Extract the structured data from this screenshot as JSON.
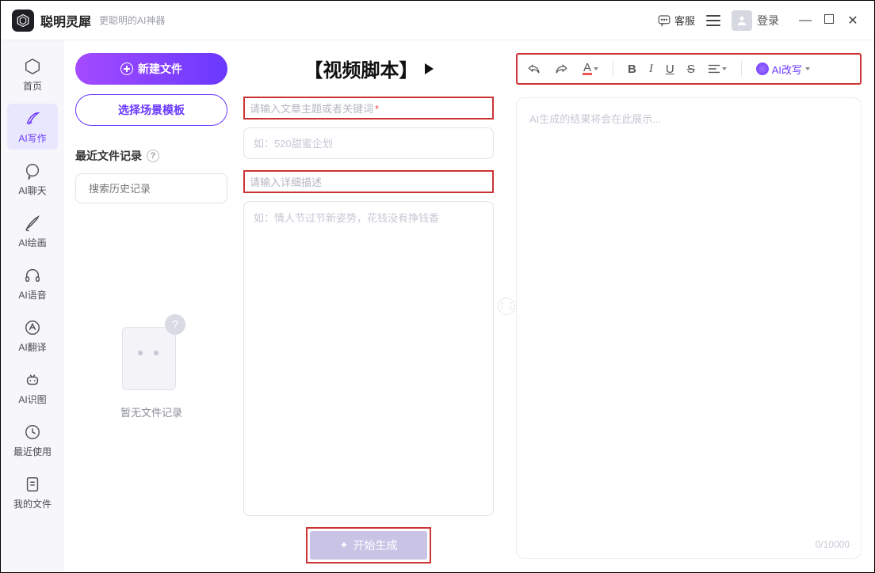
{
  "titlebar": {
    "app_name": "聪明灵犀",
    "tagline": "更聪明的AI神器",
    "kefu_label": "客服",
    "login_label": "登录"
  },
  "sidebar": {
    "items": [
      {
        "label": "首页"
      },
      {
        "label": "AI写作"
      },
      {
        "label": "AI聊天"
      },
      {
        "label": "AI绘画"
      },
      {
        "label": "AI语音"
      },
      {
        "label": "AI翻译"
      },
      {
        "label": "AI识图"
      },
      {
        "label": "最近使用"
      },
      {
        "label": "我的文件"
      }
    ],
    "active_index": 1
  },
  "leftcol": {
    "new_file_label": "新建文件",
    "select_template_label": "选择场景模板",
    "recent_header": "最近文件记录",
    "search_placeholder": "搜索历史记录",
    "empty_label": "暂无文件记录"
  },
  "center": {
    "title": "【视频脚本】",
    "field1_label": "请输入文章主题或者关键词",
    "field1_required": "*",
    "field1_placeholder": "如：520甜蜜企划",
    "field2_label": "请输入详细描述",
    "field2_placeholder": "如：情人节过节新姿势，花钱没有挣钱香",
    "generate_label": "开始生成"
  },
  "right": {
    "toolbar": {
      "font_letter": "A",
      "bold": "B",
      "italic": "I",
      "underline": "U",
      "strike": "S",
      "ai_rewrite_label": "AI改写"
    },
    "placeholder": "AI生成的结果将会在此展示...",
    "counter": "0/10000"
  }
}
